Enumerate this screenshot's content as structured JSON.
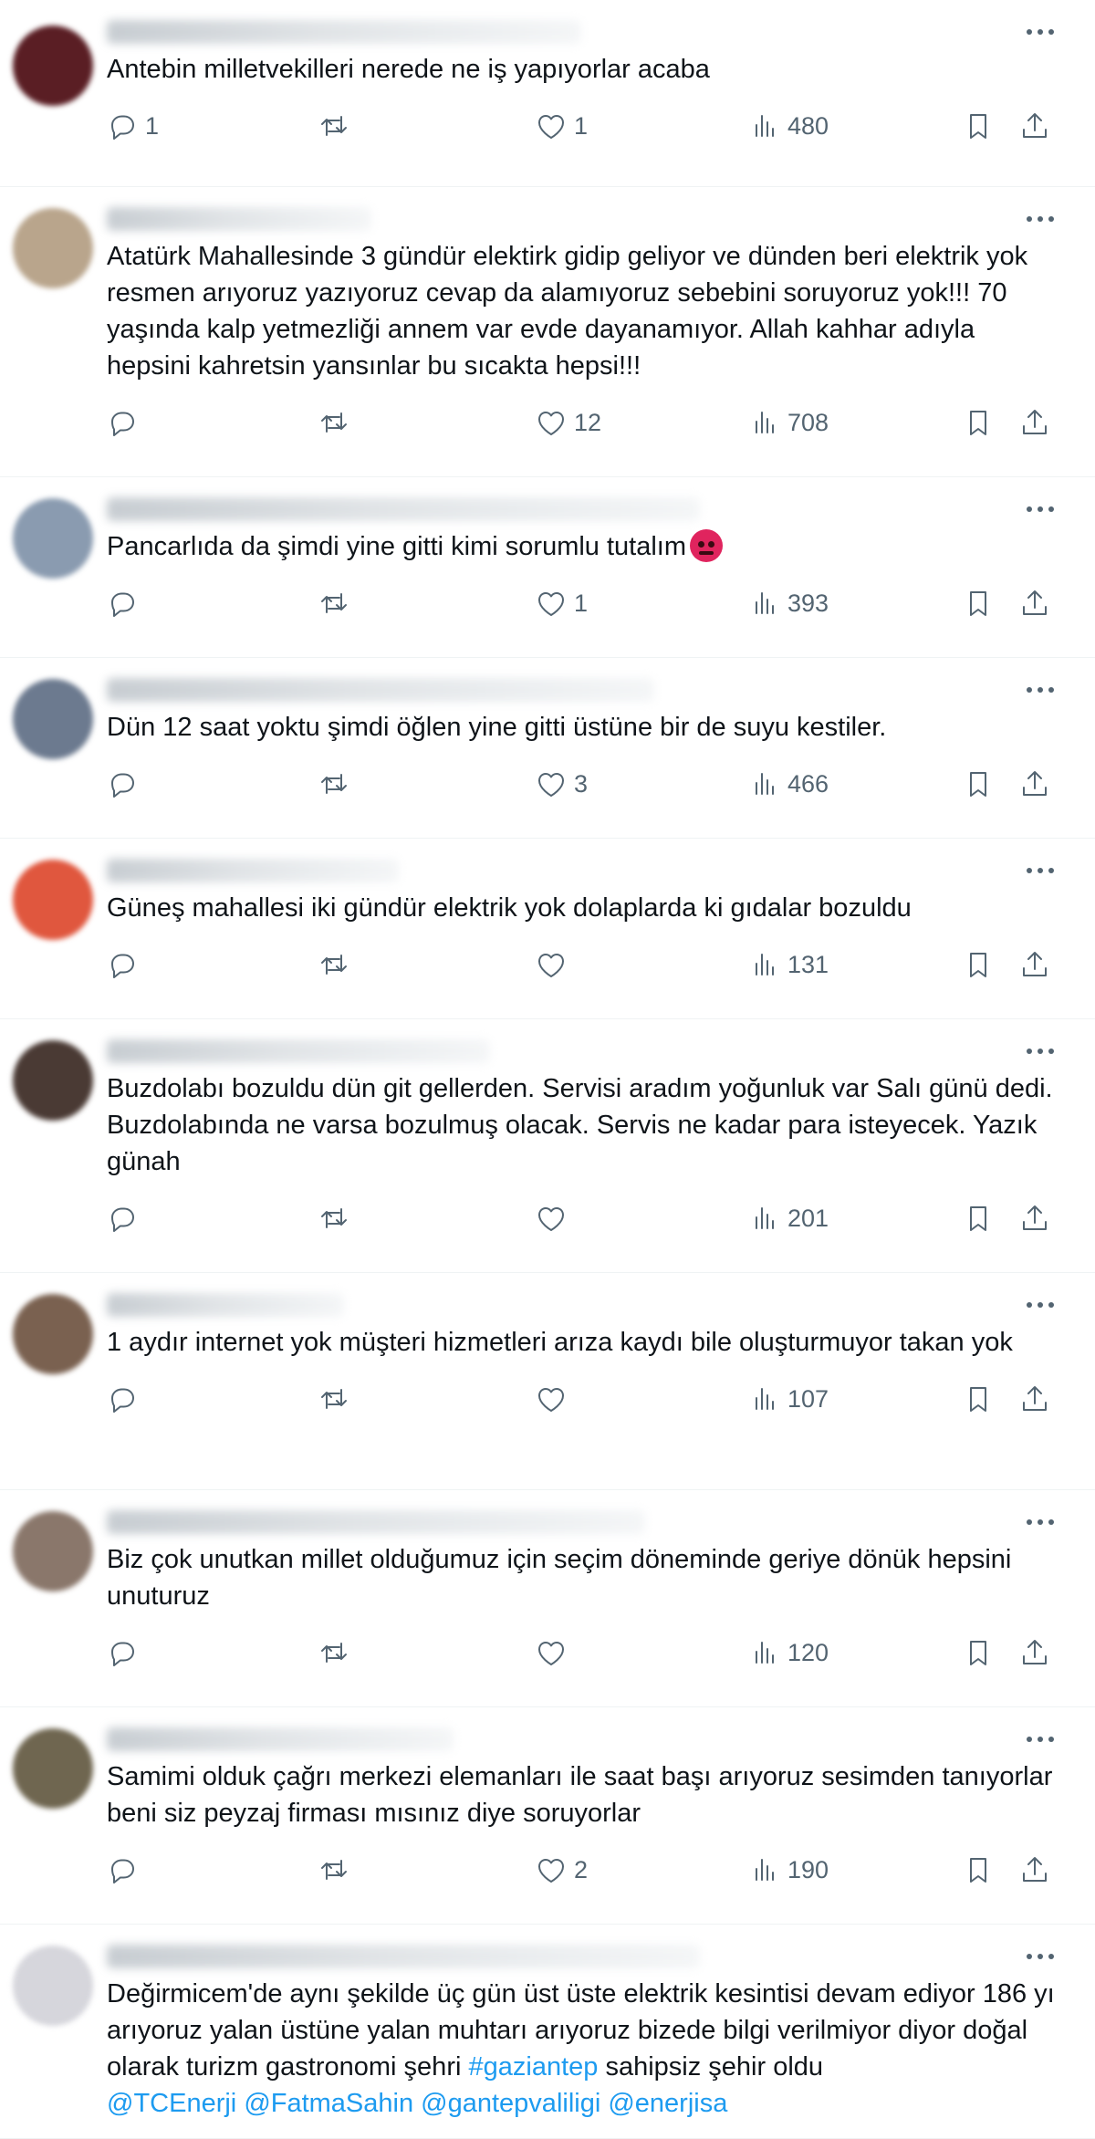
{
  "tweets": [
    {
      "text": "Antebin milletvekilleri nerede ne iş yapıyorlar acaba",
      "replies": "1",
      "retweets": "",
      "likes": "1",
      "views": "480",
      "avatar_color": "#5a1e24"
    },
    {
      "text": "Atatürk Mahallesinde 3 gündür elektirk gidip geliyor ve dünden beri elektrik yok resmen arıyoruz yazıyoruz cevap da alamıyoruz sebebini soruyoruz yok!!! 70 yaşında kalp yetmezliği annem var evde dayanamıyor. Allah kahhar adıyla hepsini kahretsin yansınlar bu sıcakta hepsi!!!",
      "replies": "",
      "retweets": "",
      "likes": "12",
      "views": "708",
      "avatar_color": "#b9a58c"
    },
    {
      "text": "Pancarlıda da şimdi yine gitti kimi sorumlu tutalım",
      "emoji": "angry-face",
      "replies": "",
      "retweets": "",
      "likes": "1",
      "views": "393",
      "avatar_color": "#8a9bb0"
    },
    {
      "text": "Dün 12 saat yoktu şimdi öğlen yine gitti üstüne bir de suyu kestiler.",
      "replies": "",
      "retweets": "",
      "likes": "3",
      "views": "466",
      "avatar_color": "#6c7a8f"
    },
    {
      "text": "Güneş mahallesi iki gündür elektrik yok dolaplarda ki gıdalar bozuldu",
      "replies": "",
      "retweets": "",
      "likes": "",
      "views": "131",
      "avatar_color": "#e0573e"
    },
    {
      "text": "Buzdolabı bozuldu dün git gellerden. Servisi aradım yoğunluk var Salı günü dedi. Buzdolabında ne varsa bozulmuş olacak. Servis ne kadar para isteyecek. Yazık günah",
      "replies": "",
      "retweets": "",
      "likes": "",
      "views": "201",
      "avatar_color": "#4a3a34"
    },
    {
      "text": "1 aydır internet yok müşteri hizmetleri arıza kaydı bile oluşturmuyor takan yok",
      "replies": "",
      "retweets": "",
      "likes": "",
      "views": "107",
      "avatar_color": "#7a6150"
    },
    {
      "text": "Biz çok unutkan millet olduğumuz için seçim döneminde geriye dönük hepsini unuturuz",
      "replies": "",
      "retweets": "",
      "likes": "",
      "views": "120",
      "avatar_color": "#8a776b"
    },
    {
      "text": "Samimi olduk çağrı merkezi elemanları ile saat başı arıyoruz sesimden tanıyorlar beni siz peyzaj firması mısınız diye soruyorlar",
      "replies": "",
      "retweets": "",
      "likes": "2",
      "views": "190",
      "avatar_color": "#6f6650"
    },
    {
      "text_parts": [
        {
          "t": "Değirmicem'de aynı şekilde üç gün üst üste elektrik kesintisi devam ediyor 186 yı arıyoruz yalan üstüne yalan muhtarı arıyoruz bizede bilgi verilmiyor diyor doğal olarak turizm gastronomi şehri ",
          "link": false
        },
        {
          "t": "#gaziantep",
          "link": true
        },
        {
          "t": " sahipsiz şehir oldu\n",
          "link": false
        },
        {
          "t": "@TCEnerji",
          "link": true
        },
        {
          "t": " ",
          "link": false
        },
        {
          "t": "@FatmaSahin",
          "link": true
        },
        {
          "t": " ",
          "link": false
        },
        {
          "t": "@gantepvaliligi",
          "link": true
        },
        {
          "t": " ",
          "link": false
        },
        {
          "t": "@enerjisa",
          "link": true
        }
      ],
      "avatar_color": "#d6d6dc"
    }
  ],
  "colors": {
    "link": "#1d9bf0",
    "icon": "#536471",
    "text": "#0f1419",
    "divider": "#eff3f4"
  },
  "icons": [
    "more-icon",
    "reply-icon",
    "retweet-icon",
    "like-icon",
    "views-icon",
    "bookmark-icon",
    "share-icon",
    "angry-face-emoji"
  ]
}
